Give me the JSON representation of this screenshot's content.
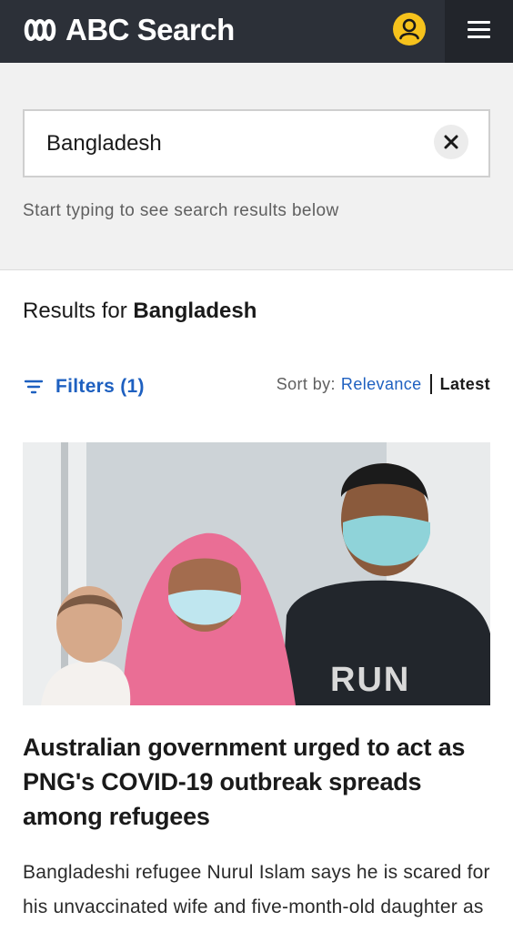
{
  "header": {
    "brand": "ABC Search",
    "account_icon": "user-account-icon",
    "menu_icon": "hamburger-menu-icon",
    "colors": {
      "bar": "#2c3038",
      "account": "#f6c21c"
    }
  },
  "search": {
    "value": "Bangladesh",
    "clear_icon": "close-icon",
    "hint": "Start typing to see search results below"
  },
  "results": {
    "prefix": "Results for ",
    "query": "Bangladesh"
  },
  "controls": {
    "filters_label": "Filters (1)",
    "sort_label": "Sort by:",
    "sort_options": [
      "Relevance",
      "Latest"
    ],
    "link_color": "#1e60c0"
  },
  "article": {
    "image_text": "RUN",
    "title": "Australian government urged to act as PNG's COVID-19 outbreak spreads among refugees",
    "description": "Bangladeshi refugee Nurul Islam says he is scared for his unvaccinated wife and five-month-old daughter as Papua New Guinea's outbreak spreads."
  }
}
